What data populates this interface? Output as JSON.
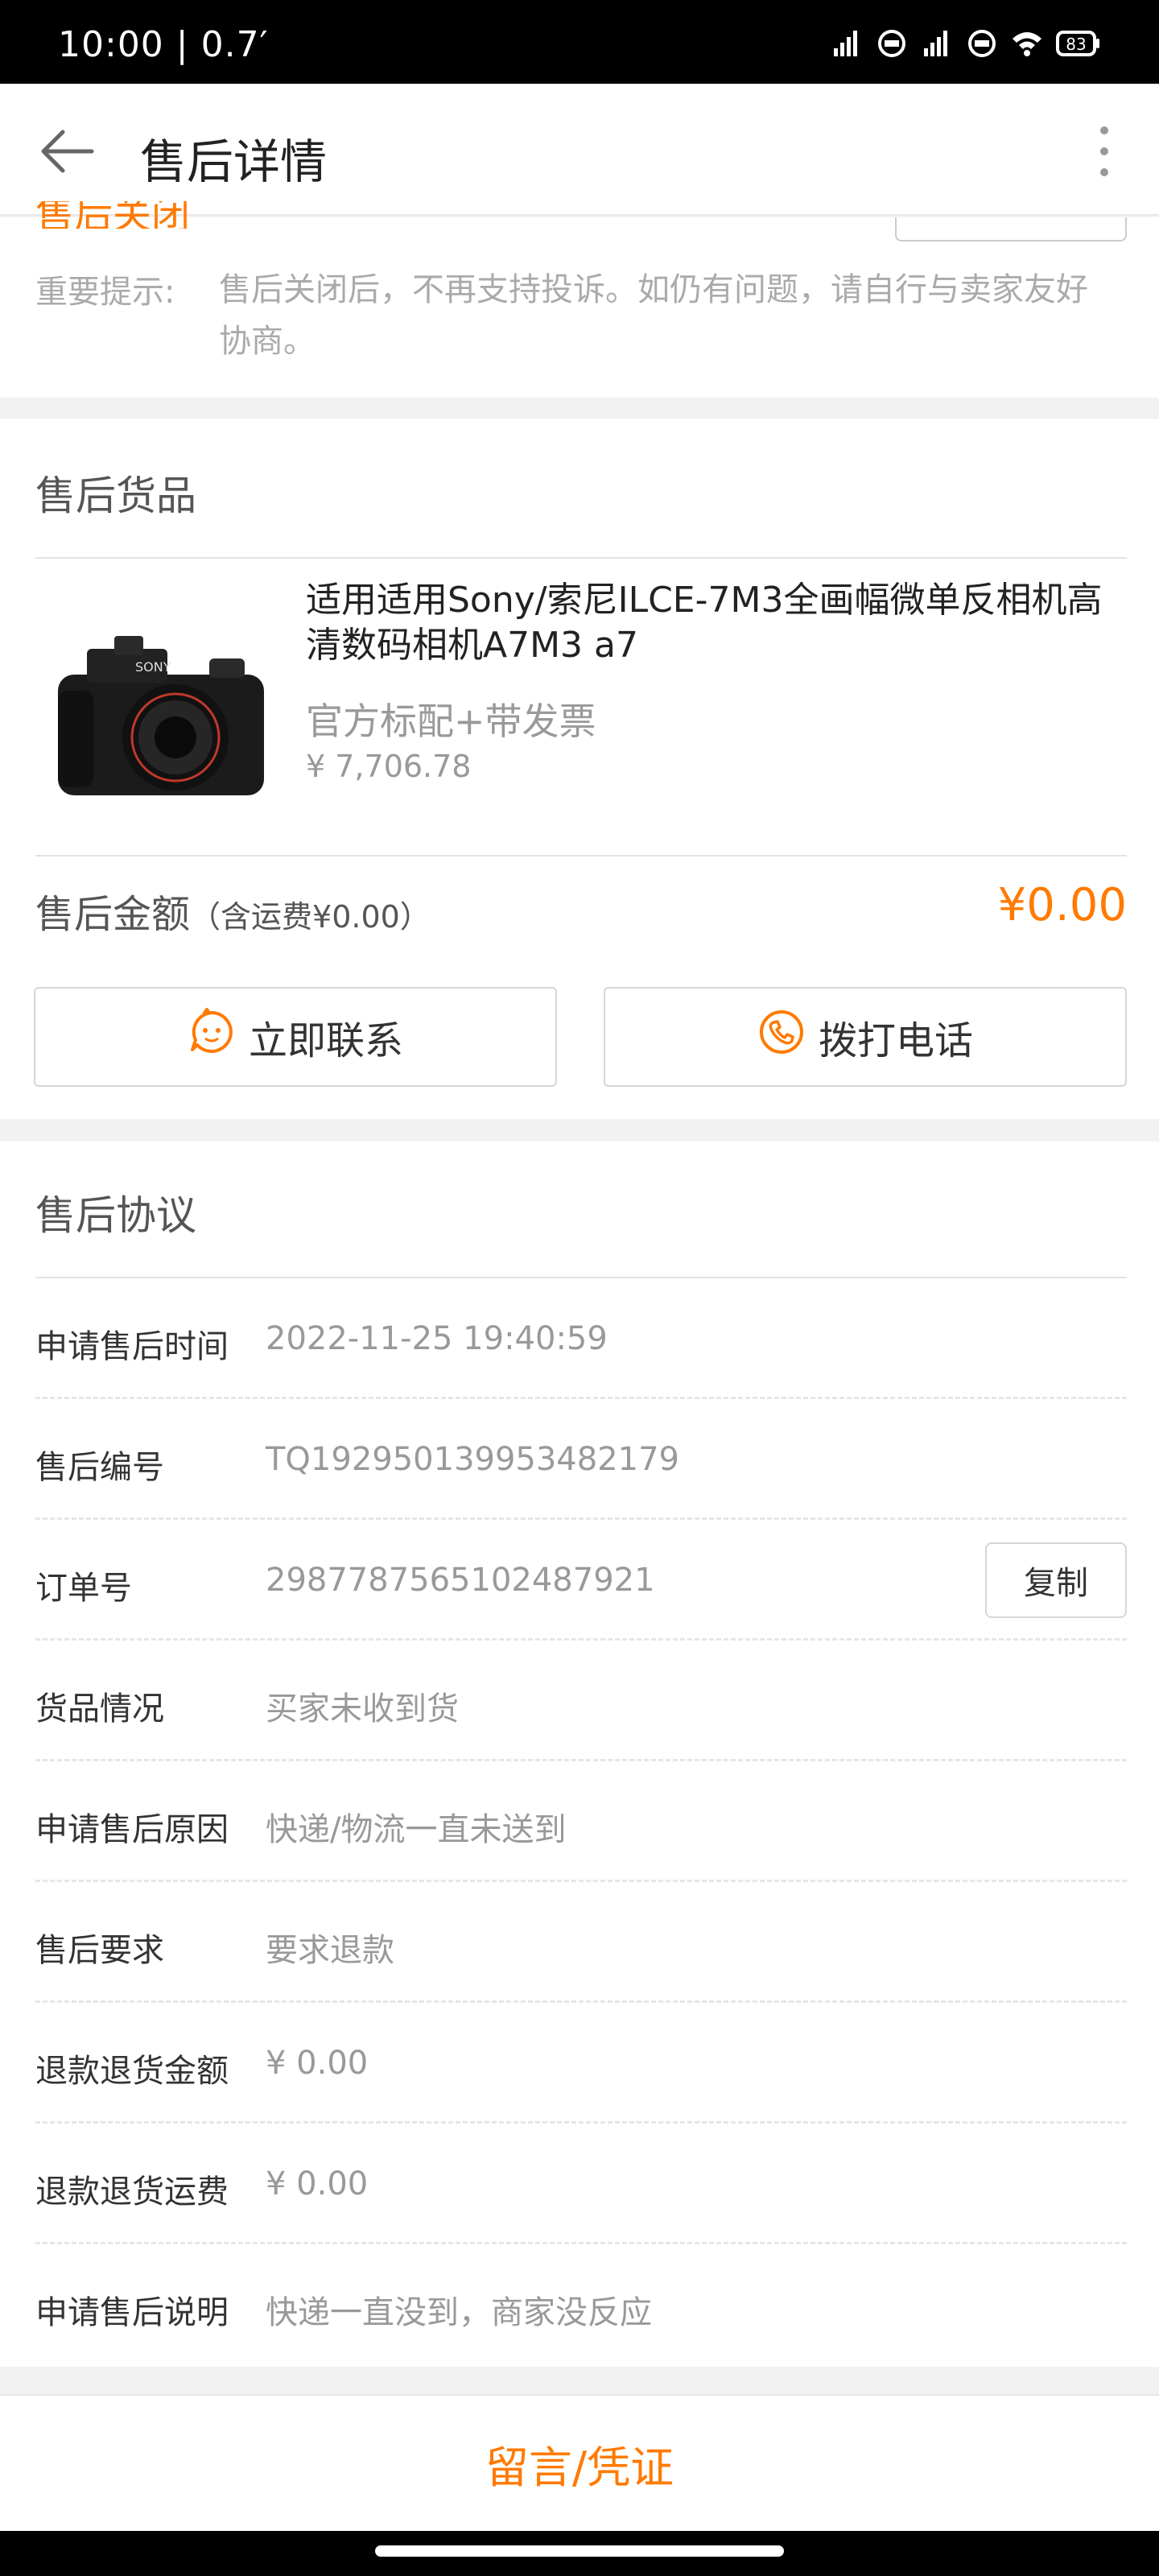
{
  "status_bar": {
    "time": "10:00 | 0.7′",
    "battery": "83"
  },
  "nav": {
    "title": "售后详情"
  },
  "notice": {
    "status_text": "售后关闭",
    "tip_label": "重要提示:",
    "tip_text": "售后关闭后，不再支持投诉。如仍有问题，请自行与卖家友好协商。"
  },
  "goods": {
    "section_title": "售后货品",
    "product": {
      "name": "适用适用Sony/索尼ILCE-7M3全画幅微单反相机高清数码相机A7M3 a7",
      "spec": "官方标配+带发票",
      "price": "¥ 7,706.78",
      "image_brand": "SONY"
    },
    "amount_label": "售后金额",
    "amount_note": "（含运费¥0.00）",
    "amount_value": "¥0.00",
    "contact_label": "立即联系",
    "call_label": "拨打电话"
  },
  "agreement": {
    "section_title": "售后协议",
    "rows": [
      {
        "label": "申请售后时间",
        "value": "2022-11-25 19:40:59"
      },
      {
        "label": "售后编号",
        "value": "TQ192950139953482179"
      },
      {
        "label": "订单号",
        "value": "2987787565102487921"
      },
      {
        "label": "货品情况",
        "value": "买家未收到货"
      },
      {
        "label": "申请售后原因",
        "value": "快递/物流一直未送到"
      },
      {
        "label": "售后要求",
        "value": "要求退款"
      },
      {
        "label": "退款退货金额",
        "value": "¥ 0.00"
      },
      {
        "label": "退款退货运费",
        "value": "¥ 0.00"
      },
      {
        "label": "申请售后说明",
        "value": "快递一直没到，商家没反应"
      }
    ],
    "copy_label": "复制"
  },
  "bottom": {
    "label": "留言/凭证"
  },
  "colors": {
    "accent": "#ff7a00",
    "muted": "#999999"
  }
}
